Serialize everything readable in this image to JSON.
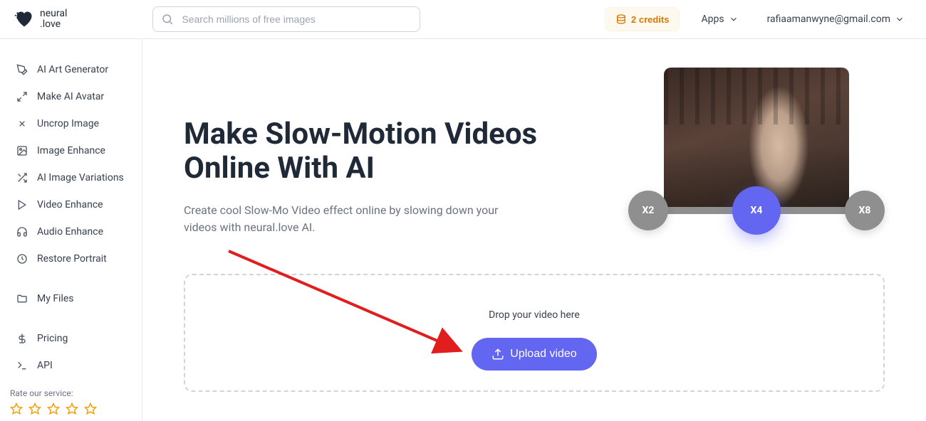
{
  "brand": {
    "line1": "neural",
    "line2": ".love"
  },
  "search": {
    "placeholder": "Search millions of free images"
  },
  "header": {
    "credits_label": "2 credits",
    "apps_label": "Apps",
    "user_email": "rafiaamanwyne@gmail.com"
  },
  "sidebar": {
    "items": [
      {
        "label": "AI Art Generator"
      },
      {
        "label": "Make AI Avatar"
      },
      {
        "label": "Uncrop Image"
      },
      {
        "label": "Image Enhance"
      },
      {
        "label": "AI Image Variations"
      },
      {
        "label": "Video Enhance"
      },
      {
        "label": "Audio Enhance"
      },
      {
        "label": "Restore Portrait"
      }
    ],
    "my_files": "My Files",
    "pricing": "Pricing",
    "api": "API",
    "rate_label": "Rate our service:"
  },
  "hero": {
    "title": "Make Slow-Motion Videos Online With AI",
    "desc": "Create cool Slow-Mo Video effect online by slowing down your videos with neural.love AI."
  },
  "slider": {
    "x2": "X2",
    "x4": "X4",
    "x8": "X8"
  },
  "dropzone": {
    "label": "Drop your video here",
    "button": "Upload video"
  }
}
